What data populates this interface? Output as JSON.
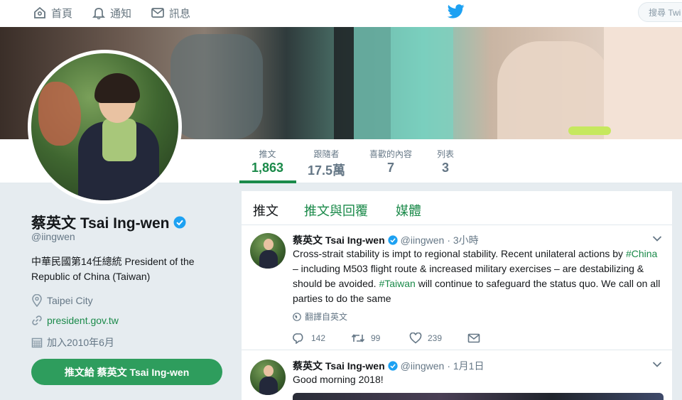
{
  "nav": {
    "home": "首頁",
    "notifications": "通知",
    "messages": "訊息",
    "search_placeholder": "搜尋 Twi"
  },
  "profile": {
    "name": "蔡英文 Tsai Ing-wen",
    "handle": "@iingwen",
    "bio": "中華民國第14任總統 President of the Republic of China (Taiwan)",
    "location": "Taipei City",
    "website": "president.gov.tw",
    "joined": "加入2010年6月",
    "tweet_to": "推文給 蔡英文 Tsai Ing-wen"
  },
  "stats": {
    "tweets": {
      "label": "推文",
      "value": "1,863"
    },
    "followers": {
      "label": "跟隨者",
      "value": "17.5萬"
    },
    "likes": {
      "label": "喜歡的內容",
      "value": "7"
    },
    "lists": {
      "label": "列表",
      "value": "3"
    }
  },
  "tabs": [
    "推文",
    "推文與回覆",
    "媒體"
  ],
  "tweets": [
    {
      "name": "蔡英文 Tsai Ing-wen",
      "handle": "@iingwen",
      "time": "· 3小時",
      "text_1": "Cross-strait stability is impt to regional stability. Recent unilateral actions by ",
      "tag_1": "#China",
      "text_2": " – including M503 flight route & increased military exercises – are destabilizing & should be avoided. ",
      "tag_2": "#Taiwan",
      "text_3": " will continue to safeguard the status quo. We call on all parties to do the same",
      "translate": "翻譯自英文",
      "replies": "142",
      "retweets": "99",
      "likes": "239"
    },
    {
      "name": "蔡英文 Tsai Ing-wen",
      "handle": "@iingwen",
      "time": "· 1月1日",
      "text": "Good morning 2018!"
    }
  ],
  "colors": {
    "accent": "#1b8a4a",
    "button": "#2e9d5d",
    "verified": "#1da1f2",
    "twitter": "#1da1f2"
  }
}
